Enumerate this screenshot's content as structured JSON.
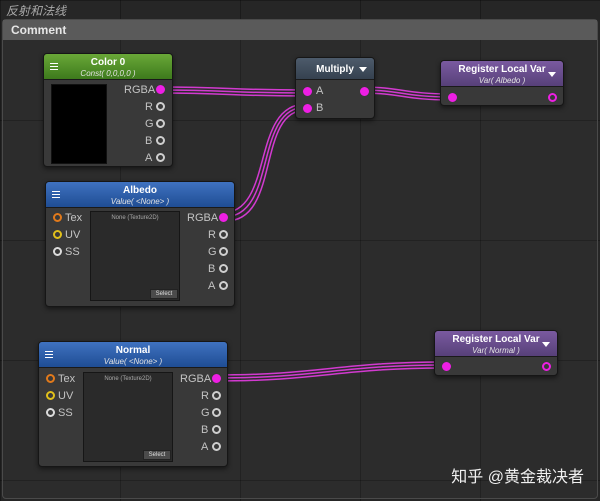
{
  "page": {
    "title": "反射和法线",
    "comment_label": "Comment"
  },
  "watermark": "知乎 @黄金裁决者",
  "colors": {
    "wire": "#d23ad0",
    "port_filled": "#ee1fe4",
    "tex_port": "#e27a1b",
    "uv_port": "#e1c01b"
  },
  "nodes": {
    "color0": {
      "title": "Color 0",
      "subtitle": "Const( 0,0,0,0 )",
      "ports": [
        "RGBA",
        "R",
        "G",
        "B",
        "A"
      ]
    },
    "albedo": {
      "title": "Albedo",
      "subtitle": "Value( <None> )",
      "inputs": [
        "Tex",
        "UV",
        "SS"
      ],
      "outputs": [
        "RGBA",
        "R",
        "G",
        "B",
        "A"
      ],
      "texture_label": "None (Texture2D)",
      "select_label": "Select"
    },
    "normal": {
      "title": "Normal",
      "subtitle": "Value( <None> )",
      "inputs": [
        "Tex",
        "UV",
        "SS"
      ],
      "outputs": [
        "RGBA",
        "R",
        "G",
        "B",
        "A"
      ],
      "texture_label": "None (Texture2D)",
      "select_label": "Select"
    },
    "multiply": {
      "title": "Multiply",
      "inputs": [
        "A",
        "B"
      ]
    },
    "register_albedo": {
      "title": "Register Local Var",
      "subtitle": "Var( Albedo )"
    },
    "register_normal": {
      "title": "Register Local Var",
      "subtitle": "Var( Normal )"
    }
  }
}
